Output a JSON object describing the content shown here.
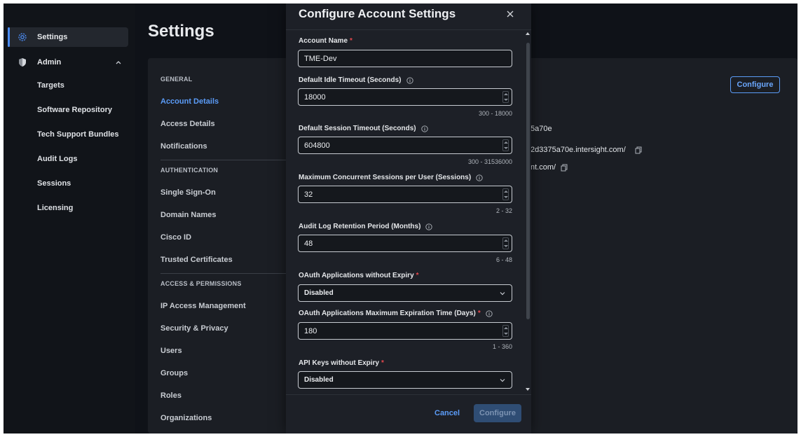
{
  "sidebar": {
    "settings_label": "Settings",
    "admin_label": "Admin",
    "items": [
      {
        "label": "Targets"
      },
      {
        "label": "Software Repository"
      },
      {
        "label": "Tech Support Bundles"
      },
      {
        "label": "Audit Logs"
      },
      {
        "label": "Sessions"
      },
      {
        "label": "Licensing"
      }
    ]
  },
  "page": {
    "title": "Settings",
    "nav": {
      "general_header": "GENERAL",
      "general": [
        {
          "label": "Account Details",
          "active": true
        },
        {
          "label": "Access Details"
        },
        {
          "label": "Notifications"
        }
      ],
      "auth_header": "AUTHENTICATION",
      "auth": [
        {
          "label": "Single Sign-On"
        },
        {
          "label": "Domain Names"
        },
        {
          "label": "Cisco ID"
        },
        {
          "label": "Trusted Certificates"
        }
      ],
      "access_header": "ACCESS & PERMISSIONS",
      "access": [
        {
          "label": "IP Access Management"
        },
        {
          "label": "Security & Privacy"
        },
        {
          "label": "Users"
        },
        {
          "label": "Groups"
        },
        {
          "label": "Roles"
        },
        {
          "label": "Organizations"
        }
      ]
    },
    "configure_label": "Configure",
    "details": {
      "partial_id": "5a70e",
      "partial_url1": "2d3375a70e.intersight.com/",
      "partial_url2": "nt.com/"
    }
  },
  "modal": {
    "title": "Configure Account Settings",
    "fields": {
      "account_name": {
        "label": "Account Name",
        "value": "TME-Dev"
      },
      "idle_timeout": {
        "label": "Default Idle Timeout (Seconds)",
        "value": "18000",
        "range": "300 - 18000"
      },
      "session_timeout": {
        "label": "Default Session Timeout (Seconds)",
        "value": "604800",
        "range": "300 - 31536000"
      },
      "max_sessions": {
        "label": "Maximum Concurrent Sessions per User (Sessions)",
        "value": "32",
        "range": "2 - 32"
      },
      "audit_retention": {
        "label": "Audit Log Retention Period (Months)",
        "value": "48",
        "range": "6 - 48"
      },
      "oauth_no_expiry": {
        "label": "OAuth Applications without Expiry",
        "value": "Disabled"
      },
      "oauth_max_exp": {
        "label": "OAuth Applications Maximum Expiration Time (Days)",
        "value": "180",
        "range": "1 - 360"
      },
      "api_keys_no_expiry": {
        "label": "API Keys without Expiry",
        "value": "Disabled"
      }
    },
    "cancel_label": "Cancel",
    "configure_label": "Configure"
  },
  "colors": {
    "accent": "#5b9cf8",
    "required": "#e5484d",
    "background": "#0f1218",
    "panel": "#1b1e24",
    "modal": "#1d2027"
  }
}
